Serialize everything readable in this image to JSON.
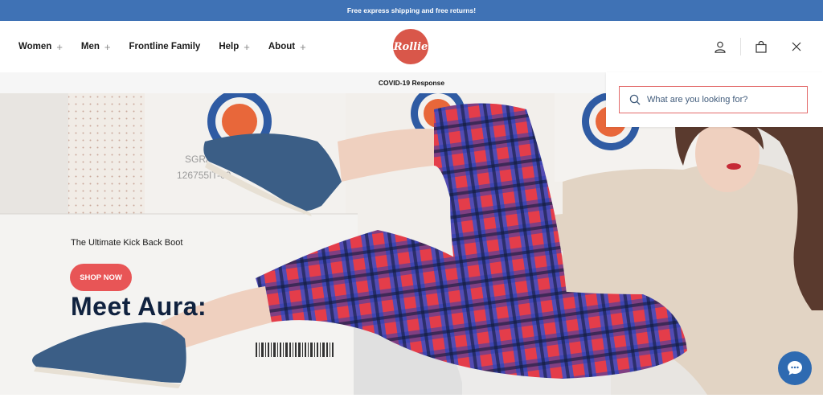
{
  "announcement": "Free express shipping and free returns!",
  "nav": {
    "items": [
      {
        "label": "Women",
        "plus": "+"
      },
      {
        "label": "Men",
        "plus": "+"
      },
      {
        "label": "Frontline Family",
        "plus": ""
      },
      {
        "label": "Help",
        "plus": "+"
      },
      {
        "label": "About",
        "plus": "+"
      }
    ],
    "logo_text": "Rollie",
    "icons": [
      "account-icon",
      "cart-icon",
      "close-icon"
    ]
  },
  "covid_banner": "COVID-19 Response",
  "hero": {
    "title": "Meet Aura:",
    "subtitle": "The Ultimate Kick Back Boot",
    "cta_label": "SHOP NOW",
    "box_text_1": "SGRAS",
    "box_text_2": "126755IT-09"
  },
  "search": {
    "placeholder": "What are you looking for?"
  },
  "colors": {
    "announce_bg": "#3f72b5",
    "cta": "#e85556",
    "logo": "#d9574a",
    "title": "#10223f",
    "chat": "#2e6ab1"
  }
}
